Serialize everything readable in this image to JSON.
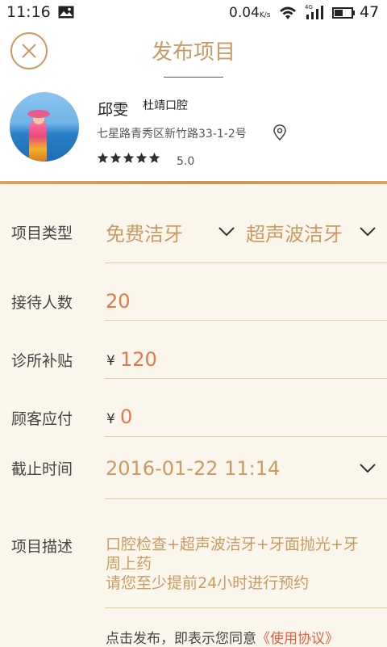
{
  "status_bar": {
    "time": "11:16",
    "speed": "0.04",
    "speed_unit": "K/s",
    "network": "4G",
    "battery_level": "47"
  },
  "header": {
    "title": "发布项目",
    "close_icon": "close-icon"
  },
  "profile": {
    "name": "邱雯",
    "clinic": "杜靖口腔",
    "address": "七星路青秀区新竹路33-1-2号",
    "rating_stars": 5,
    "rating_value": "5.0"
  },
  "form": {
    "project_type": {
      "label": "项目类型",
      "category": "免费洁牙",
      "subcategory": "超声波洁牙"
    },
    "reception": {
      "label": "接待人数",
      "value": "20"
    },
    "clinic_subsidy": {
      "label": "诊所补贴",
      "currency": "¥",
      "value": "120"
    },
    "customer_pay": {
      "label": "顾客应付",
      "currency": "¥",
      "value": "0"
    },
    "deadline": {
      "label": "截止时间",
      "value": "2016-01-22 11:14"
    },
    "description": {
      "label": "项目描述",
      "line1": "口腔检查+超声波洁牙+牙面抛光+牙",
      "line2": "周上药",
      "line3": "请您至少提前24小时进行预约"
    },
    "agreement": {
      "text": "点击发布，即表示您同意",
      "link": "《使用协议》"
    }
  },
  "colors": {
    "accent": "#c89b62",
    "value_red": "#e07a4a",
    "background": "#faf6ec"
  }
}
